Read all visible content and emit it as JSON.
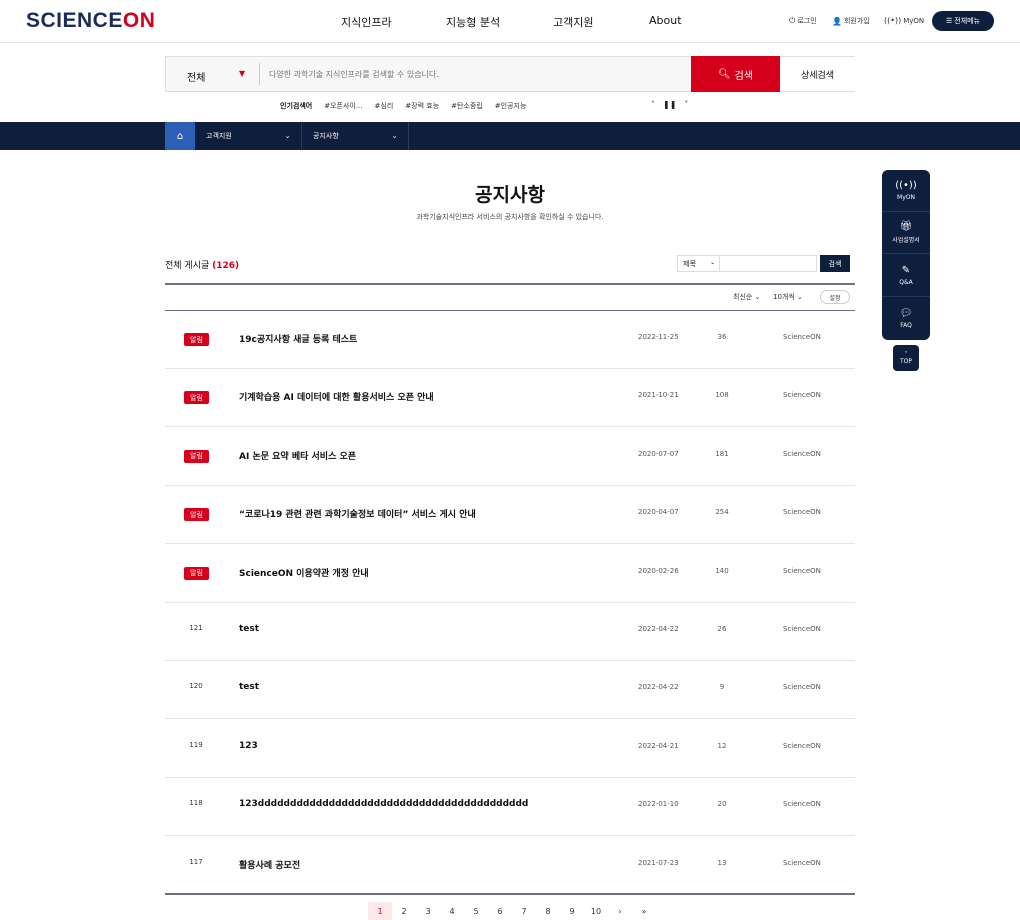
{
  "header": {
    "logo": {
      "prefix": "SCIENCE",
      "suffix": "ON"
    },
    "nav": [
      "지식인프라",
      "지능형 분석",
      "고객지원",
      "About"
    ],
    "util": {
      "login": "로그인",
      "signup": "회원가입",
      "myon": "MyON",
      "allmenu": "전체메뉴"
    }
  },
  "search": {
    "scope": "전체",
    "placeholder": "다양한 과학기술 지식인프라를 검색할 수 있습니다.",
    "button": "검색",
    "advanced": "상세검색",
    "popular_title": "인기검색어",
    "popular": [
      "#오픈사이...",
      "#심리",
      "#장력 효능",
      "#탄소중립",
      "#인공지능"
    ]
  },
  "breadcrumb": [
    "고객지원",
    "공지사항"
  ],
  "page": {
    "title": "공지사항",
    "description": "과학기술지식인프라 서비스의 공지사항을 확인하실 수 있습니다."
  },
  "board": {
    "total_label": "전체 게시글",
    "total_count": "(126)",
    "filter_field": "제목",
    "filter_button": "검색",
    "sort": "최신순",
    "page_size": "10개씩",
    "apply": "설정",
    "rows": [
      {
        "no": "",
        "badge": "알림",
        "title": "19c공지사항 새글 등록 테스트",
        "date": "2022-11-25",
        "views": "36",
        "author": "ScienceON"
      },
      {
        "no": "",
        "badge": "알림",
        "title": "기계학습용 AI 데이터에 대한 활용서비스 오픈 안내",
        "date": "2021-10-21",
        "views": "108",
        "author": "ScienceON"
      },
      {
        "no": "",
        "badge": "알림",
        "title": "AI 논문 요약 베타 서비스 오픈",
        "date": "2020-07-07",
        "views": "181",
        "author": "ScienceON"
      },
      {
        "no": "",
        "badge": "알림",
        "title": "“코로나19 관련 관련 과학기술정보 데이터” 서비스 게시 안내",
        "date": "2020-04-07",
        "views": "254",
        "author": "ScienceON"
      },
      {
        "no": "",
        "badge": "알림",
        "title": "ScienceON 이용약관 개정 안내",
        "date": "2020-02-26",
        "views": "140",
        "author": "ScienceON"
      },
      {
        "no": "121",
        "badge": "",
        "title": "test",
        "date": "2022-04-22",
        "views": "26",
        "author": "ScienceON"
      },
      {
        "no": "120",
        "badge": "",
        "title": "test",
        "date": "2022-04-22",
        "views": "9",
        "author": "ScienceON"
      },
      {
        "no": "119",
        "badge": "",
        "title": "123",
        "date": "2022-04-21",
        "views": "12",
        "author": "ScienceON"
      },
      {
        "no": "118",
        "badge": "",
        "title": "123dddddddddddddddddddddddddddddddddddddddddd",
        "date": "2022-01-10",
        "views": "20",
        "author": "ScienceON"
      },
      {
        "no": "117",
        "badge": "",
        "title": "활용사례 공모전",
        "date": "2021-07-23",
        "views": "13",
        "author": "ScienceON"
      }
    ]
  },
  "pagination": {
    "pages": [
      "1",
      "2",
      "3",
      "4",
      "5",
      "6",
      "7",
      "8",
      "9",
      "10"
    ],
    "current": "1",
    "next": "›",
    "last": "»"
  },
  "quick_menu": [
    "MyON",
    "사업설명서",
    "Q&A",
    "FAQ"
  ],
  "top_label": "TOP"
}
